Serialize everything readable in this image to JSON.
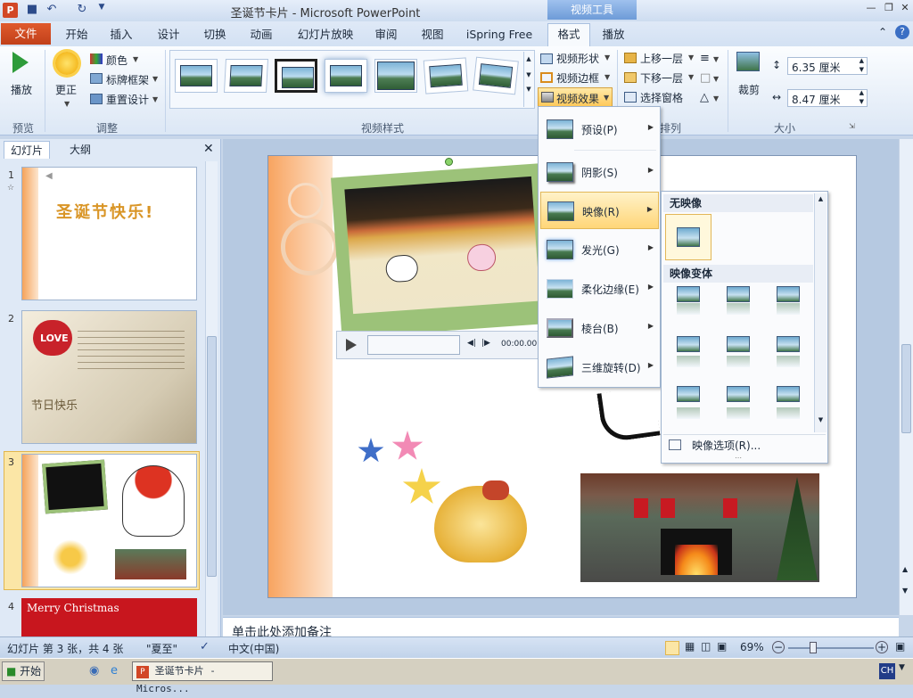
{
  "window": {
    "title": "圣诞节卡片 - Microsoft PowerPoint",
    "app_icon": "P",
    "contextual_tab_group": "视频工具",
    "controls": [
      "minimize-icon",
      "restore-icon",
      "close-icon"
    ]
  },
  "qat": [
    "save-icon",
    "undo-icon",
    "redo-icon",
    "customize-icon"
  ],
  "tabs": {
    "file": "文件",
    "items": [
      "开始",
      "插入",
      "设计",
      "切换",
      "动画",
      "幻灯片放映",
      "审阅",
      "视图",
      "iSpring Free"
    ],
    "format": "格式",
    "playback": "播放"
  },
  "ribbon": {
    "preview": {
      "play": "播放",
      "group": "预览"
    },
    "adjust": {
      "correct": "更正",
      "color": "颜色",
      "poster_frame": "标牌框架",
      "reset_design": "重置设计",
      "group": "调整"
    },
    "video_styles": {
      "group": "视频样式",
      "shape": "视频形状",
      "border": "视频边框",
      "effects": "视频效果"
    },
    "arrange": {
      "bring_forward": "上移一层",
      "send_backward": "下移一层",
      "selection_pane": "选择窗格",
      "group": "排列"
    },
    "size": {
      "crop": "裁剪",
      "height": "6.35 厘米",
      "width": "8.47 厘米",
      "group": "大小"
    }
  },
  "left_pane": {
    "tab_slides": "幻灯片",
    "tab_outline": "大纲",
    "slides": [
      {
        "num": "1",
        "text": "圣诞节快乐!"
      },
      {
        "num": "2",
        "text": "LOVE",
        "caption": "节日快乐"
      },
      {
        "num": "3"
      },
      {
        "num": "4",
        "text": "Merry Christmas"
      }
    ]
  },
  "video_player": {
    "time": "00:00.00"
  },
  "effects_menu": {
    "items": [
      "预设(P)",
      "阴影(S)",
      "映像(R)",
      "发光(G)",
      "柔化边缘(E)",
      "棱台(B)",
      "三维旋转(D)"
    ]
  },
  "reflection_menu": {
    "none_head": "无映像",
    "variants_head": "映像变体",
    "options": "映像选项(R)..."
  },
  "notes": {
    "placeholder": "单击此处添加备注"
  },
  "status": {
    "slide_info": "幻灯片 第 3 张，共 4 张",
    "theme": "\"夏至\"",
    "language": "中文(中国)",
    "zoom": "69%"
  },
  "taskbar": {
    "start": "开始",
    "task": "圣诞节卡片 - Micros...",
    "ime": "CH"
  }
}
